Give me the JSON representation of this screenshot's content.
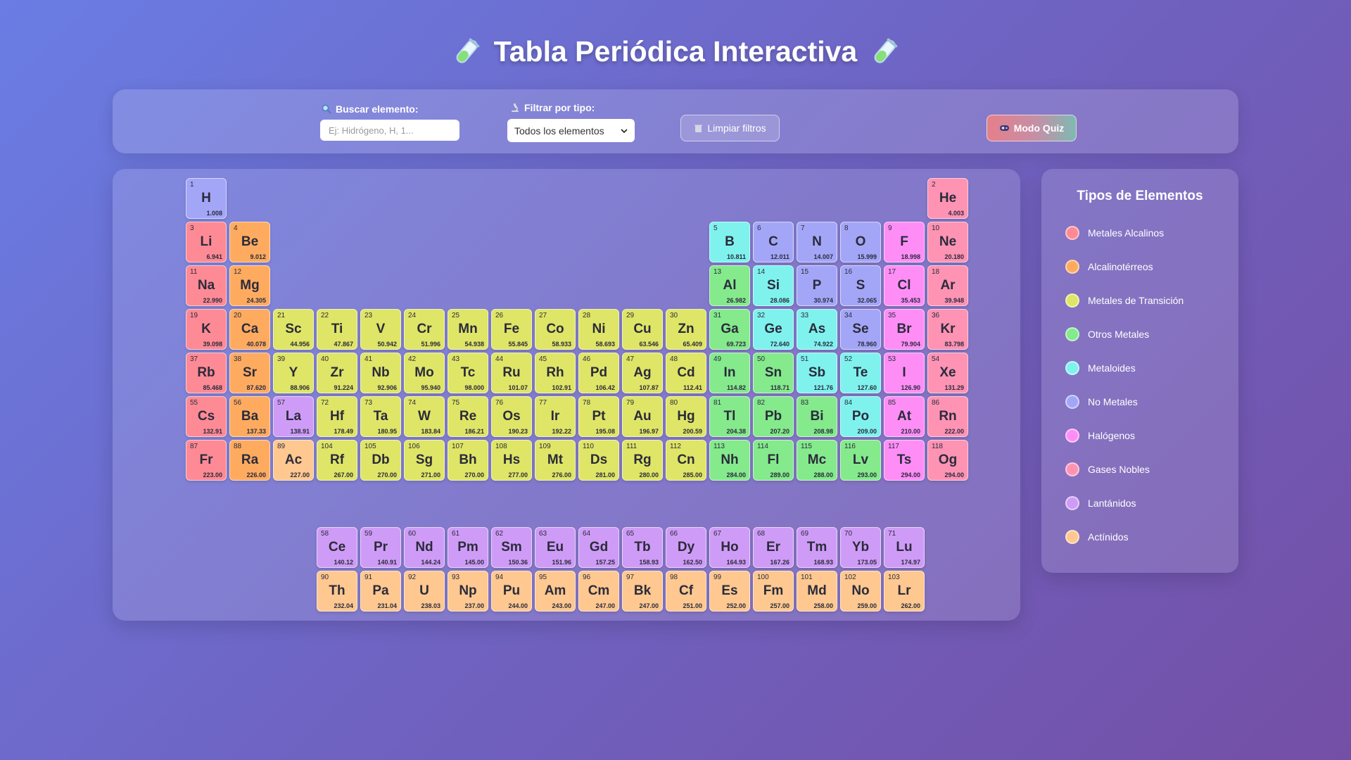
{
  "header": {
    "title": "Tabla Periódica Interactiva",
    "icon_left": "test-tube-icon",
    "icon_right": "test-tube-icon"
  },
  "controls": {
    "search_label": "Buscar elemento:",
    "search_placeholder": "Ej: Hidrógeno, H, 1...",
    "search_value": "",
    "filter_label": "Filtrar por tipo:",
    "filter_selected": "Todos los elementos",
    "clear_label": "Limpiar filtros",
    "quiz_label": "Modo Quiz"
  },
  "colors": {
    "alkali": "#fe8a95",
    "alkaline": "#feab60",
    "transition": "#dfe566",
    "post": "#84ea8c",
    "metalloid": "#7ff2ee",
    "nonmetal": "#a3a6f7",
    "halogen": "#fe8ef6",
    "noble": "#fe93b4",
    "lanthanide": "#ce9cf6",
    "actinide": "#fec890"
  },
  "legend": {
    "title": "Tipos de Elementos",
    "items": [
      {
        "key": "alkali",
        "label": "Metales Alcalinos"
      },
      {
        "key": "alkaline",
        "label": "Alcalinotérreos"
      },
      {
        "key": "transition",
        "label": "Metales de Transición"
      },
      {
        "key": "post",
        "label": "Otros Metales"
      },
      {
        "key": "metalloid",
        "label": "Metaloides"
      },
      {
        "key": "nonmetal",
        "label": "No Metales"
      },
      {
        "key": "halogen",
        "label": "Halógenos"
      },
      {
        "key": "noble",
        "label": "Gases Nobles"
      },
      {
        "key": "lanthanide",
        "label": "Lantánidos"
      },
      {
        "key": "actinide",
        "label": "Actínidos"
      }
    ]
  },
  "elements": [
    [
      "1",
      "H",
      "1.008",
      "nonmetal",
      1,
      1
    ],
    [
      "2",
      "He",
      "4.003",
      "noble",
      1,
      18
    ],
    [
      "3",
      "Li",
      "6.941",
      "alkali",
      2,
      1
    ],
    [
      "4",
      "Be",
      "9.012",
      "alkaline",
      2,
      2
    ],
    [
      "5",
      "B",
      "10.811",
      "metalloid",
      2,
      13
    ],
    [
      "6",
      "C",
      "12.011",
      "nonmetal",
      2,
      14
    ],
    [
      "7",
      "N",
      "14.007",
      "nonmetal",
      2,
      15
    ],
    [
      "8",
      "O",
      "15.999",
      "nonmetal",
      2,
      16
    ],
    [
      "9",
      "F",
      "18.998",
      "halogen",
      2,
      17
    ],
    [
      "10",
      "Ne",
      "20.180",
      "noble",
      2,
      18
    ],
    [
      "11",
      "Na",
      "22.990",
      "alkali",
      3,
      1
    ],
    [
      "12",
      "Mg",
      "24.305",
      "alkaline",
      3,
      2
    ],
    [
      "13",
      "Al",
      "26.982",
      "post",
      3,
      13
    ],
    [
      "14",
      "Si",
      "28.086",
      "metalloid",
      3,
      14
    ],
    [
      "15",
      "P",
      "30.974",
      "nonmetal",
      3,
      15
    ],
    [
      "16",
      "S",
      "32.065",
      "nonmetal",
      3,
      16
    ],
    [
      "17",
      "Cl",
      "35.453",
      "halogen",
      3,
      17
    ],
    [
      "18",
      "Ar",
      "39.948",
      "noble",
      3,
      18
    ],
    [
      "19",
      "K",
      "39.098",
      "alkali",
      4,
      1
    ],
    [
      "20",
      "Ca",
      "40.078",
      "alkaline",
      4,
      2
    ],
    [
      "21",
      "Sc",
      "44.956",
      "transition",
      4,
      3
    ],
    [
      "22",
      "Ti",
      "47.867",
      "transition",
      4,
      4
    ],
    [
      "23",
      "V",
      "50.942",
      "transition",
      4,
      5
    ],
    [
      "24",
      "Cr",
      "51.996",
      "transition",
      4,
      6
    ],
    [
      "25",
      "Mn",
      "54.938",
      "transition",
      4,
      7
    ],
    [
      "26",
      "Fe",
      "55.845",
      "transition",
      4,
      8
    ],
    [
      "27",
      "Co",
      "58.933",
      "transition",
      4,
      9
    ],
    [
      "28",
      "Ni",
      "58.693",
      "transition",
      4,
      10
    ],
    [
      "29",
      "Cu",
      "63.546",
      "transition",
      4,
      11
    ],
    [
      "30",
      "Zn",
      "65.409",
      "transition",
      4,
      12
    ],
    [
      "31",
      "Ga",
      "69.723",
      "post",
      4,
      13
    ],
    [
      "32",
      "Ge",
      "72.640",
      "metalloid",
      4,
      14
    ],
    [
      "33",
      "As",
      "74.922",
      "metalloid",
      4,
      15
    ],
    [
      "34",
      "Se",
      "78.960",
      "nonmetal",
      4,
      16
    ],
    [
      "35",
      "Br",
      "79.904",
      "halogen",
      4,
      17
    ],
    [
      "36",
      "Kr",
      "83.798",
      "noble",
      4,
      18
    ],
    [
      "37",
      "Rb",
      "85.468",
      "alkali",
      5,
      1
    ],
    [
      "38",
      "Sr",
      "87.620",
      "alkaline",
      5,
      2
    ],
    [
      "39",
      "Y",
      "88.906",
      "transition",
      5,
      3
    ],
    [
      "40",
      "Zr",
      "91.224",
      "transition",
      5,
      4
    ],
    [
      "41",
      "Nb",
      "92.906",
      "transition",
      5,
      5
    ],
    [
      "42",
      "Mo",
      "95.940",
      "transition",
      5,
      6
    ],
    [
      "43",
      "Tc",
      "98.000",
      "transition",
      5,
      7
    ],
    [
      "44",
      "Ru",
      "101.07",
      "transition",
      5,
      8
    ],
    [
      "45",
      "Rh",
      "102.91",
      "transition",
      5,
      9
    ],
    [
      "46",
      "Pd",
      "106.42",
      "transition",
      5,
      10
    ],
    [
      "47",
      "Ag",
      "107.87",
      "transition",
      5,
      11
    ],
    [
      "48",
      "Cd",
      "112.41",
      "transition",
      5,
      12
    ],
    [
      "49",
      "In",
      "114.82",
      "post",
      5,
      13
    ],
    [
      "50",
      "Sn",
      "118.71",
      "post",
      5,
      14
    ],
    [
      "51",
      "Sb",
      "121.76",
      "metalloid",
      5,
      15
    ],
    [
      "52",
      "Te",
      "127.60",
      "metalloid",
      5,
      16
    ],
    [
      "53",
      "I",
      "126.90",
      "halogen",
      5,
      17
    ],
    [
      "54",
      "Xe",
      "131.29",
      "noble",
      5,
      18
    ],
    [
      "55",
      "Cs",
      "132.91",
      "alkali",
      6,
      1
    ],
    [
      "56",
      "Ba",
      "137.33",
      "alkaline",
      6,
      2
    ],
    [
      "57",
      "La",
      "138.91",
      "lanthanide",
      6,
      3
    ],
    [
      "72",
      "Hf",
      "178.49",
      "transition",
      6,
      4
    ],
    [
      "73",
      "Ta",
      "180.95",
      "transition",
      6,
      5
    ],
    [
      "74",
      "W",
      "183.84",
      "transition",
      6,
      6
    ],
    [
      "75",
      "Re",
      "186.21",
      "transition",
      6,
      7
    ],
    [
      "76",
      "Os",
      "190.23",
      "transition",
      6,
      8
    ],
    [
      "77",
      "Ir",
      "192.22",
      "transition",
      6,
      9
    ],
    [
      "78",
      "Pt",
      "195.08",
      "transition",
      6,
      10
    ],
    [
      "79",
      "Au",
      "196.97",
      "transition",
      6,
      11
    ],
    [
      "80",
      "Hg",
      "200.59",
      "transition",
      6,
      12
    ],
    [
      "81",
      "Tl",
      "204.38",
      "post",
      6,
      13
    ],
    [
      "82",
      "Pb",
      "207.20",
      "post",
      6,
      14
    ],
    [
      "83",
      "Bi",
      "208.98",
      "post",
      6,
      15
    ],
    [
      "84",
      "Po",
      "209.00",
      "metalloid",
      6,
      16
    ],
    [
      "85",
      "At",
      "210.00",
      "halogen",
      6,
      17
    ],
    [
      "86",
      "Rn",
      "222.00",
      "noble",
      6,
      18
    ],
    [
      "87",
      "Fr",
      "223.00",
      "alkali",
      7,
      1
    ],
    [
      "88",
      "Ra",
      "226.00",
      "alkaline",
      7,
      2
    ],
    [
      "89",
      "Ac",
      "227.00",
      "actinide",
      7,
      3
    ],
    [
      "104",
      "Rf",
      "267.00",
      "transition",
      7,
      4
    ],
    [
      "105",
      "Db",
      "270.00",
      "transition",
      7,
      5
    ],
    [
      "106",
      "Sg",
      "271.00",
      "transition",
      7,
      6
    ],
    [
      "107",
      "Bh",
      "270.00",
      "transition",
      7,
      7
    ],
    [
      "108",
      "Hs",
      "277.00",
      "transition",
      7,
      8
    ],
    [
      "109",
      "Mt",
      "276.00",
      "transition",
      7,
      9
    ],
    [
      "110",
      "Ds",
      "281.00",
      "transition",
      7,
      10
    ],
    [
      "111",
      "Rg",
      "280.00",
      "transition",
      7,
      11
    ],
    [
      "112",
      "Cn",
      "285.00",
      "transition",
      7,
      12
    ],
    [
      "113",
      "Nh",
      "284.00",
      "post",
      7,
      13
    ],
    [
      "114",
      "Fl",
      "289.00",
      "post",
      7,
      14
    ],
    [
      "115",
      "Mc",
      "288.00",
      "post",
      7,
      15
    ],
    [
      "116",
      "Lv",
      "293.00",
      "post",
      7,
      16
    ],
    [
      "117",
      "Ts",
      "294.00",
      "halogen",
      7,
      17
    ],
    [
      "118",
      "Og",
      "294.00",
      "noble",
      7,
      18
    ],
    [
      "58",
      "Ce",
      "140.12",
      "lanthanide",
      9,
      4
    ],
    [
      "59",
      "Pr",
      "140.91",
      "lanthanide",
      9,
      5
    ],
    [
      "60",
      "Nd",
      "144.24",
      "lanthanide",
      9,
      6
    ],
    [
      "61",
      "Pm",
      "145.00",
      "lanthanide",
      9,
      7
    ],
    [
      "62",
      "Sm",
      "150.36",
      "lanthanide",
      9,
      8
    ],
    [
      "63",
      "Eu",
      "151.96",
      "lanthanide",
      9,
      9
    ],
    [
      "64",
      "Gd",
      "157.25",
      "lanthanide",
      9,
      10
    ],
    [
      "65",
      "Tb",
      "158.93",
      "lanthanide",
      9,
      11
    ],
    [
      "66",
      "Dy",
      "162.50",
      "lanthanide",
      9,
      12
    ],
    [
      "67",
      "Ho",
      "164.93",
      "lanthanide",
      9,
      13
    ],
    [
      "68",
      "Er",
      "167.26",
      "lanthanide",
      9,
      14
    ],
    [
      "69",
      "Tm",
      "168.93",
      "lanthanide",
      9,
      15
    ],
    [
      "70",
      "Yb",
      "173.05",
      "lanthanide",
      9,
      16
    ],
    [
      "71",
      "Lu",
      "174.97",
      "lanthanide",
      9,
      17
    ],
    [
      "90",
      "Th",
      "232.04",
      "actinide",
      10,
      4
    ],
    [
      "91",
      "Pa",
      "231.04",
      "actinide",
      10,
      5
    ],
    [
      "92",
      "U",
      "238.03",
      "actinide",
      10,
      6
    ],
    [
      "93",
      "Np",
      "237.00",
      "actinide",
      10,
      7
    ],
    [
      "94",
      "Pu",
      "244.00",
      "actinide",
      10,
      8
    ],
    [
      "95",
      "Am",
      "243.00",
      "actinide",
      10,
      9
    ],
    [
      "96",
      "Cm",
      "247.00",
      "actinide",
      10,
      10
    ],
    [
      "97",
      "Bk",
      "247.00",
      "actinide",
      10,
      11
    ],
    [
      "98",
      "Cf",
      "251.00",
      "actinide",
      10,
      12
    ],
    [
      "99",
      "Es",
      "252.00",
      "actinide",
      10,
      13
    ],
    [
      "100",
      "Fm",
      "257.00",
      "actinide",
      10,
      14
    ],
    [
      "101",
      "Md",
      "258.00",
      "actinide",
      10,
      15
    ],
    [
      "102",
      "No",
      "259.00",
      "actinide",
      10,
      16
    ],
    [
      "103",
      "Lr",
      "262.00",
      "actinide",
      10,
      17
    ]
  ]
}
